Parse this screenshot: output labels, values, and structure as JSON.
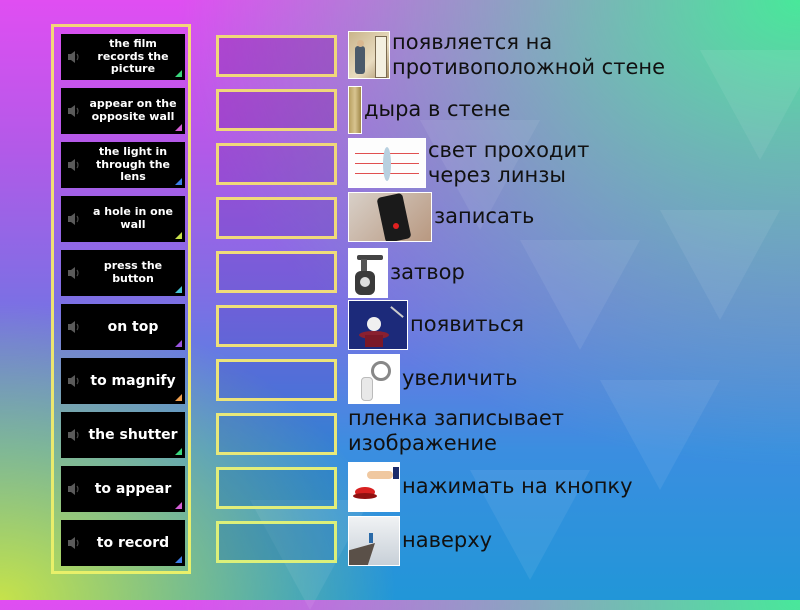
{
  "colors": {
    "tile_bg": "#000000",
    "tile_text": "#ffffff",
    "panel_border": "#f0e86a",
    "slot_border": "#f0e07a",
    "clue_text": "#111111"
  },
  "tiles": [
    {
      "label": "the film records the picture",
      "icon": "speaker-icon",
      "corner_color": "#3ad67e"
    },
    {
      "label": "appear on the opposite wall",
      "icon": "speaker-icon",
      "corner_color": "#d35fd6"
    },
    {
      "label": "the light in through the lens",
      "icon": "speaker-icon",
      "corner_color": "#3c7ee8"
    },
    {
      "label": "a hole in one wall",
      "icon": "speaker-icon",
      "corner_color": "#c8e04a"
    },
    {
      "label": "press the button",
      "icon": "speaker-icon",
      "corner_color": "#47c4d8"
    },
    {
      "label": "on top",
      "icon": "speaker-icon",
      "corner_color": "#9a55e0"
    },
    {
      "label": "to magnify",
      "icon": "speaker-icon",
      "corner_color": "#f0a050"
    },
    {
      "label": "the shutter",
      "icon": "speaker-icon",
      "corner_color": "#3ad67e"
    },
    {
      "label": "to appear",
      "icon": "speaker-icon",
      "corner_color": "#d35fd6"
    },
    {
      "label": "to record",
      "icon": "speaker-icon",
      "corner_color": "#3c7ee8"
    }
  ],
  "slots": [
    {
      "value": ""
    },
    {
      "value": ""
    },
    {
      "value": ""
    },
    {
      "value": ""
    },
    {
      "value": ""
    },
    {
      "value": ""
    },
    {
      "value": ""
    },
    {
      "value": ""
    },
    {
      "value": ""
    },
    {
      "value": ""
    }
  ],
  "clues": [
    {
      "text": "появляется на противоположной стене",
      "image": "camera-obscura-man-image"
    },
    {
      "text": "дыра в стене",
      "image": "wooden-wall-image"
    },
    {
      "text": "свет проходит через линзы",
      "image": "lens-diagram-image"
    },
    {
      "text": "записать",
      "image": "phone-recording-image"
    },
    {
      "text": "затвор",
      "image": "valve-shutter-image"
    },
    {
      "text": "появиться",
      "image": "magic-hat-rabbit-image"
    },
    {
      "text": "увеличить",
      "image": "magnifying-glass-figure-image"
    },
    {
      "text": "пленка записывает изображение",
      "image": ""
    },
    {
      "text": "нажимать на кнопку",
      "image": "finger-red-button-image"
    },
    {
      "text": "наверху",
      "image": "person-on-cliff-image"
    }
  ]
}
